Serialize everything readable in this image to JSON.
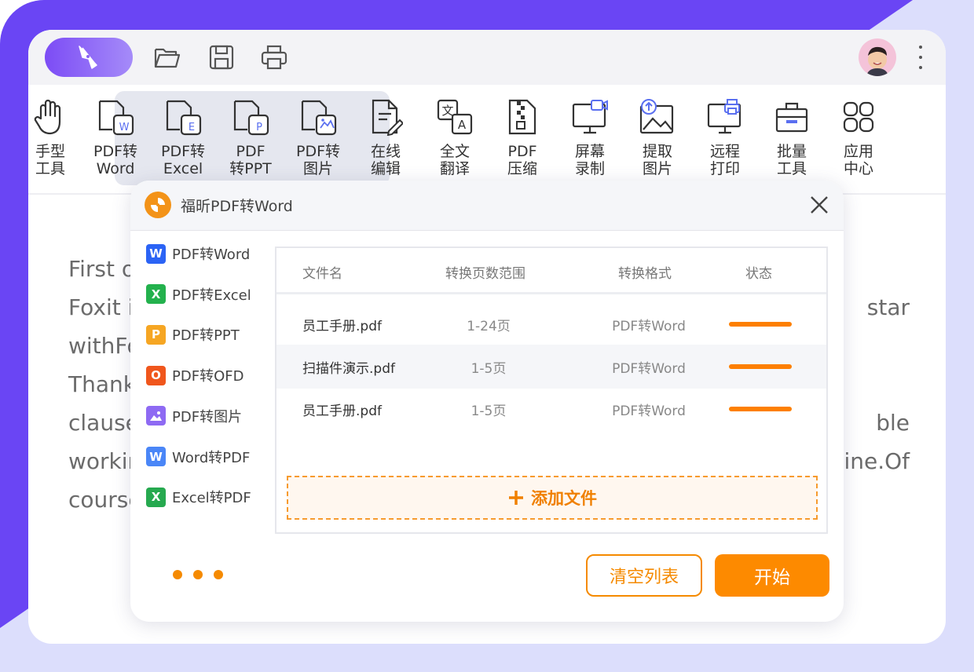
{
  "colors": {
    "brand": "#6a45f4",
    "accent": "#fd8a00"
  },
  "toolbar": {
    "icons": [
      "pen-logo-icon",
      "folder-open-icon",
      "save-icon",
      "print-icon"
    ]
  },
  "ribbon": {
    "items": [
      {
        "label": "手型\n工具",
        "icon": "hand-icon"
      },
      {
        "label": "PDF转\nWord",
        "icon": "pdf-to-word-icon"
      },
      {
        "label": "PDF转\nExcel",
        "icon": "pdf-to-excel-icon"
      },
      {
        "label": "PDF\n转PPT",
        "icon": "pdf-to-ppt-icon"
      },
      {
        "label": "PDF转\n图片",
        "icon": "pdf-to-image-icon"
      },
      {
        "label": "在线\n编辑",
        "icon": "edit-document-icon"
      },
      {
        "label": "全文\n翻译",
        "icon": "translate-icon"
      },
      {
        "label": "PDF\n压缩",
        "icon": "compress-icon"
      },
      {
        "label": "屏幕\n录制",
        "icon": "screen-record-icon"
      },
      {
        "label": "提取\n图片",
        "icon": "extract-image-icon"
      },
      {
        "label": "远程\n打印",
        "icon": "remote-print-icon"
      },
      {
        "label": "批量\n工具",
        "icon": "batch-tool-icon"
      },
      {
        "label": "应用\n中心",
        "icon": "app-center-icon"
      }
    ]
  },
  "document": {
    "lines": [
      {
        "left": "First o",
        "right": ""
      },
      {
        "left": "Foxit i",
        "right": "star"
      },
      {
        "left": "withFo",
        "right": ""
      },
      {
        "left": "Thank",
        "right": ""
      },
      {
        "left": "clause",
        "right": "ble"
      },
      {
        "left": "workin",
        "right": "line.Of"
      },
      {
        "left": "course",
        "right": ""
      }
    ]
  },
  "dialog": {
    "title": "福昕PDF转Word",
    "sidebar": [
      {
        "label": "PDF转Word",
        "badge": "W",
        "color": "#2b63f5"
      },
      {
        "label": "PDF转Excel",
        "badge": "X",
        "color": "#23b14d"
      },
      {
        "label": "PDF转PPT",
        "badge": "P",
        "color": "#f6a623"
      },
      {
        "label": "PDF转OFD",
        "badge": "O",
        "color": "#f0561c"
      },
      {
        "label": "PDF转图片",
        "badge": "",
        "color": "#8e6af3"
      },
      {
        "label": "Word转PDF",
        "badge": "W",
        "color": "#4a86f7"
      },
      {
        "label": "Excel转PDF",
        "badge": "X",
        "color": "#26a94f"
      }
    ],
    "table": {
      "headers": [
        "文件名",
        "转换页数范围",
        "转换格式",
        "状态"
      ],
      "rows": [
        {
          "name": "员工手册.pdf",
          "range": "1-24页",
          "format": "PDF转Word",
          "status": 1.0
        },
        {
          "name": "扫描件演示.pdf",
          "range": "1-5页",
          "format": "PDF转Word",
          "status": 1.0
        },
        {
          "name": "员工手册.pdf",
          "range": "1-5页",
          "format": "PDF转Word",
          "status": 1.0
        }
      ]
    },
    "add_file": "添加文件",
    "clear_label": "清空列表",
    "start_label": "开始"
  }
}
